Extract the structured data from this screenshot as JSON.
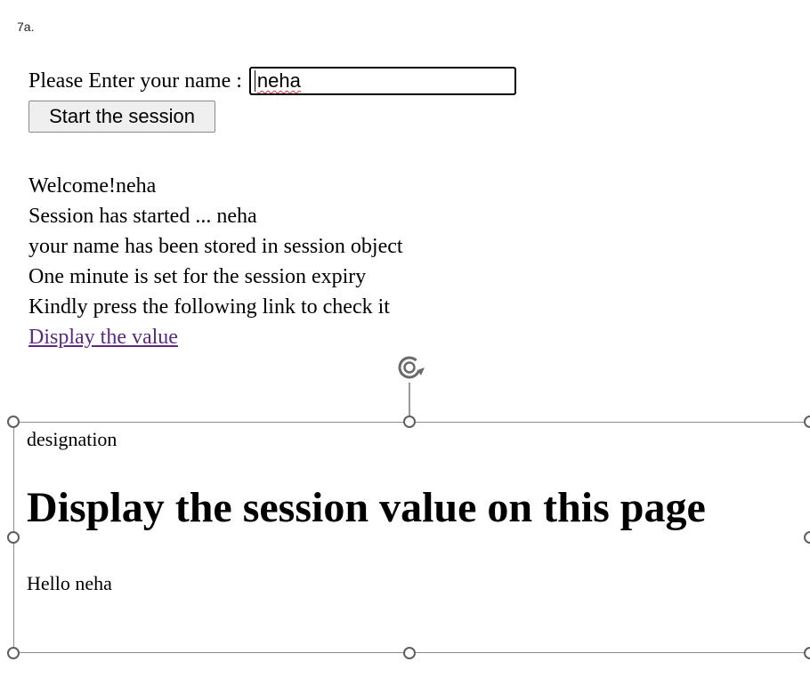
{
  "caption": "7a.",
  "form": {
    "prompt_label": "Please Enter your name :",
    "name_value": "neha",
    "start_button_label": "Start the session"
  },
  "messages": {
    "welcome": "Welcome!neha",
    "session_started": "Session has started ... neha",
    "stored": "your name has been stored in session object",
    "expiry": "One minute is set for the session expiry",
    "instruction": "Kindly press the following link to check it",
    "link_text": "Display the value"
  },
  "embedded_page": {
    "designation": "designation",
    "heading": "Display the session value on this page",
    "greeting": "Hello neha"
  },
  "colors": {
    "link_visited": "#5a2a82",
    "spellcheck_underline": "#d13438",
    "selection_border": "#8c8c8c"
  },
  "icons": {
    "rotate_handle": "rotate-icon"
  }
}
